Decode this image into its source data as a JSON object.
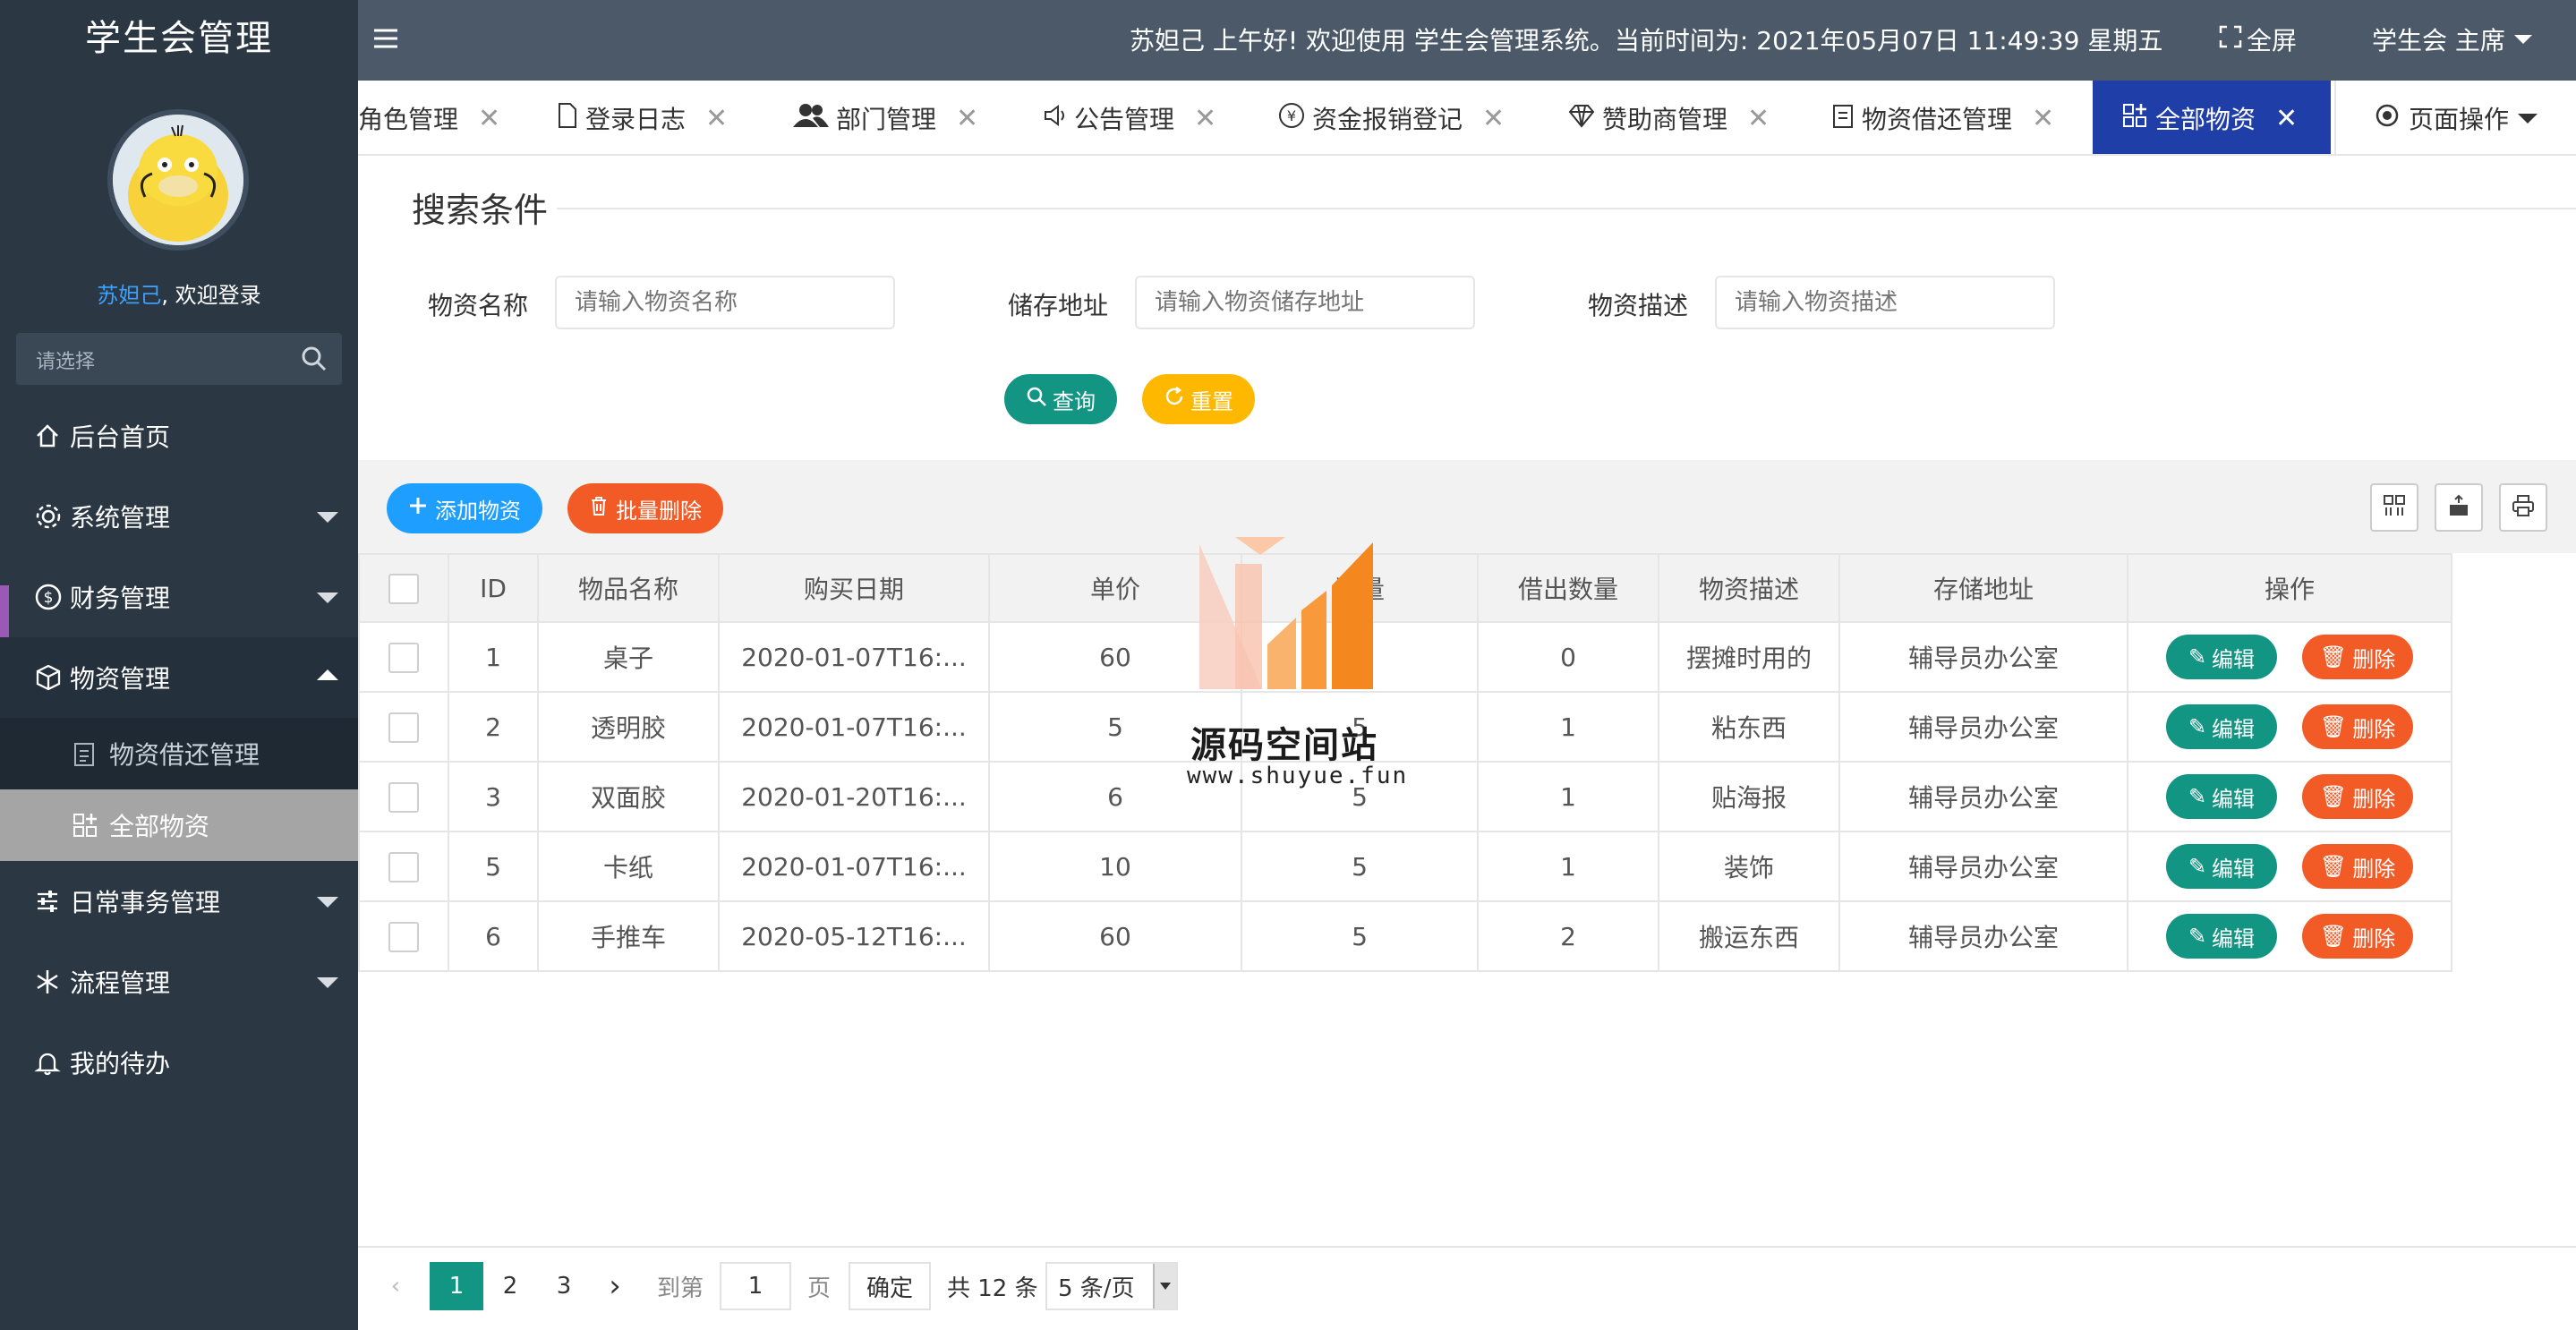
{
  "app": {
    "title": "学生会管理"
  },
  "user": {
    "name": "苏妲己",
    "welcome_suffix": ", 欢迎登录",
    "role_label": "学生会 主席"
  },
  "sidebar": {
    "search_placeholder": "请选择",
    "items": [
      {
        "label": "后台首页",
        "icon": "home-icon"
      },
      {
        "label": "系统管理",
        "icon": "gear-icon"
      },
      {
        "label": "财务管理",
        "icon": "dollar-icon"
      },
      {
        "label": "物资管理",
        "icon": "cube-icon"
      },
      {
        "label": "日常事务管理",
        "icon": "sliders-icon"
      },
      {
        "label": "流程管理",
        "icon": "snowflake-icon"
      },
      {
        "label": "我的待办",
        "icon": "bell-icon"
      }
    ],
    "sub_items": [
      {
        "label": "物资借还管理",
        "icon": "clipboard-icon"
      },
      {
        "label": "全部物资",
        "icon": "grid-plus-icon"
      }
    ]
  },
  "topbar": {
    "greeting": "苏妲己 上午好!  欢迎使用 学生会管理系统。当前时间为:  2021年05月07日 11:49:39   星期五",
    "fullscreen_label": "全屏"
  },
  "tabs": [
    {
      "label": "角色管理"
    },
    {
      "label": "登录日志"
    },
    {
      "label": "部门管理"
    },
    {
      "label": "公告管理"
    },
    {
      "label": "资金报销登记"
    },
    {
      "label": "赞助商管理"
    },
    {
      "label": "物资借还管理"
    },
    {
      "label": "全部物资"
    }
  ],
  "page_ops_label": "页面操作",
  "search": {
    "title": "搜索条件",
    "fields": [
      {
        "label": "物资名称",
        "placeholder": "请输入物资名称"
      },
      {
        "label": "储存地址",
        "placeholder": "请输入物资储存地址"
      },
      {
        "label": "物资描述",
        "placeholder": "请输入物资描述"
      }
    ],
    "query_label": "查询",
    "reset_label": "重置"
  },
  "toolbar": {
    "add_label": "添加物资",
    "batch_delete_label": "批量删除"
  },
  "table": {
    "columns": [
      "ID",
      "物品名称",
      "购买日期",
      "单价",
      "数量",
      "借出数量",
      "物资描述",
      "存储地址",
      "操作"
    ],
    "rows": [
      [
        "1",
        "桌子",
        "2020-01-07T16:...",
        "60",
        "5",
        "0",
        "摆摊时用的",
        "辅导员办公室"
      ],
      [
        "2",
        "透明胶",
        "2020-01-07T16:...",
        "5",
        "5",
        "1",
        "粘东西",
        "辅导员办公室"
      ],
      [
        "3",
        "双面胶",
        "2020-01-20T16:...",
        "6",
        "5",
        "1",
        "贴海报",
        "辅导员办公室"
      ],
      [
        "5",
        "卡纸",
        "2020-01-07T16:...",
        "10",
        "5",
        "1",
        "装饰",
        "辅导员办公室"
      ],
      [
        "6",
        "手推车",
        "2020-05-12T16:...",
        "60",
        "5",
        "2",
        "搬运东西",
        "辅导员办公室"
      ]
    ],
    "edit_label": "编辑",
    "delete_label": "删除"
  },
  "pager": {
    "pages": [
      "1",
      "2",
      "3"
    ],
    "goto_label": "到第",
    "goto_value": "1",
    "page_unit": "页",
    "confirm_label": "确定",
    "total_label": "共 12 条",
    "size_label": "5 条/页"
  },
  "watermark": {
    "title": "源码空间站",
    "url": "www.shuyue.fun"
  },
  "colors": {
    "sidebar": "#2b3743",
    "topbar": "#4b5968",
    "active_tab": "#1f3ea8",
    "teal": "#139584",
    "orange": "#f25a26",
    "blue": "#1e9fff",
    "yellow": "#ffb800"
  }
}
